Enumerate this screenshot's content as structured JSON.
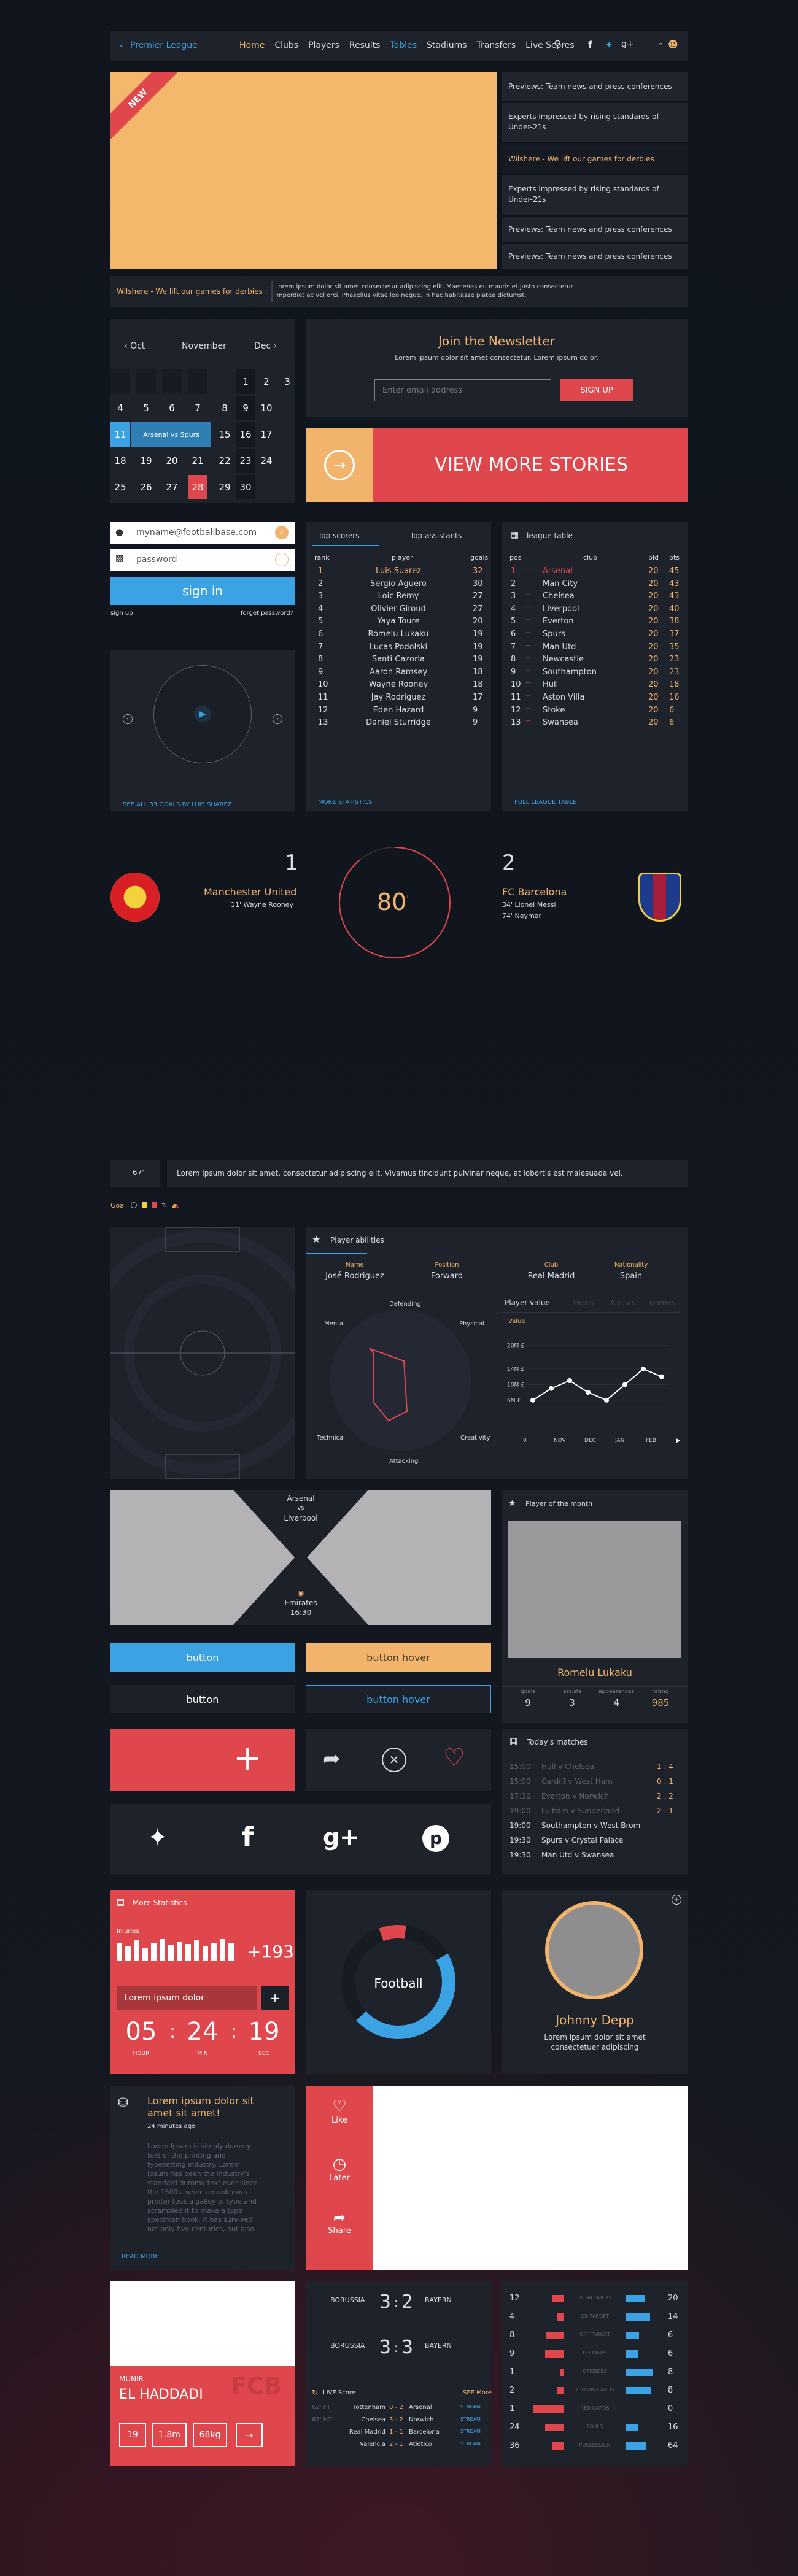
{
  "nav": {
    "brand": "Premier League",
    "links": [
      "Home",
      "Clubs",
      "Players",
      "Results",
      "Tables",
      "Stadiums",
      "Transfers",
      "Live Scores"
    ]
  },
  "hero": {
    "badge": "NEW",
    "news": [
      "Previews: Team news and press conferences",
      "Experts impressed by rising standards of Under-21s",
      "Wilshere - We lift our games for derbies",
      "Experts impressed by rising standards of Under-21s",
      "Previews: Team news and press conferences",
      "Previews: Team news and press conferences"
    ],
    "ticker_title": "Wilshere - We lift our games for derbies :",
    "ticker_text": "Lorem ipsum dolor sit amet consectetur adipiscing elit. Maecenas eu mauris et justo consectetur imperdiet ac vel orci. Phasellus vitae leo neque. In hac habitasse platea dictumst."
  },
  "calendar": {
    "prev": "Oct",
    "month": "November",
    "next": "Dec",
    "row1": [
      "1",
      "2",
      "3"
    ],
    "row2": [
      "4",
      "5",
      "6",
      "7",
      "8",
      "9",
      "10"
    ],
    "event_day": "11",
    "event_text": "Arsenal vs Spurs",
    "row3_rest": [
      "15",
      "16",
      "17"
    ],
    "row4": [
      "18",
      "19",
      "20",
      "21",
      "22",
      "23",
      "24"
    ],
    "row5": [
      "25",
      "26",
      "27",
      "28",
      "29",
      "30"
    ]
  },
  "newsletter": {
    "title": "Join the Newsletter",
    "text": "Lorem ipsum dolor sit amet consectetur. Lorem ipsum dolor.",
    "placeholder": "Enter email address",
    "button": "SIGN UP"
  },
  "stories": {
    "label": "VIEW MORE STORIES"
  },
  "login": {
    "email": "myname@footballbase.com",
    "password": "password",
    "signin": "sign in",
    "signup": "sign up",
    "forgot": "forget password?"
  },
  "player": {
    "caption": "SEE ALL 33 GOALS BY LUIS SUAREZ"
  },
  "scorers": {
    "tabs": [
      "Top scorers",
      "Top assistants"
    ],
    "headers": [
      "rank",
      "player",
      "goals"
    ],
    "rows": [
      [
        "1",
        "Luis Suarez",
        "32"
      ],
      [
        "2",
        "Sergio Aguero",
        "30"
      ],
      [
        "3",
        "Loic Remy",
        "27"
      ],
      [
        "4",
        "Olivier Giroud",
        "27"
      ],
      [
        "5",
        "Yaya Toure",
        "20"
      ],
      [
        "6",
        "Romelu Lukaku",
        "19"
      ],
      [
        "7",
        "Lucas Podolski",
        "19"
      ],
      [
        "8",
        "Santi Cazorla",
        "19"
      ],
      [
        "9",
        "Aaron Ramsey",
        "18"
      ],
      [
        "10",
        "Wayne Rooney",
        "18"
      ],
      [
        "11",
        "Jay Rodriguez",
        "17"
      ],
      [
        "12",
        "Eden Hazard",
        "9"
      ],
      [
        "13",
        "Daniel Sturridge",
        "9"
      ]
    ],
    "footer": "MORE STATISTICS"
  },
  "league": {
    "title": "league table",
    "headers": [
      "pos",
      "club",
      "pld",
      "pts"
    ],
    "rows": [
      [
        "1",
        "Arsenal",
        "20",
        "45"
      ],
      [
        "2",
        "Man City",
        "20",
        "43"
      ],
      [
        "3",
        "Chelsea",
        "20",
        "43"
      ],
      [
        "4",
        "Liverpool",
        "20",
        "40"
      ],
      [
        "5",
        "Everton",
        "20",
        "38"
      ],
      [
        "6",
        "Spurs",
        "20",
        "37"
      ],
      [
        "7",
        "Man Utd",
        "20",
        "35"
      ],
      [
        "8",
        "Newcastle",
        "20",
        "23"
      ],
      [
        "9",
        "Southampton",
        "20",
        "23"
      ],
      [
        "10",
        "Hull",
        "20",
        "18"
      ],
      [
        "11",
        "Aston Villa",
        "20",
        "16"
      ],
      [
        "12",
        "Stoke",
        "20",
        "6"
      ],
      [
        "13",
        "Swansea",
        "20",
        "6"
      ]
    ],
    "footer": "FULL LEAGUE TABLE"
  },
  "match": {
    "home_score": "1",
    "home_name": "Manchester United",
    "home_scorer": "11' Wayne Rooney",
    "minute": "80",
    "away_score": "2",
    "away_name": "FC Barcelona",
    "away_scorers": [
      "34' Lionel Messi",
      "74' Neymar"
    ]
  },
  "commentary": {
    "minute": "67'",
    "text": "Lorem ipsum dolor sit amet, consectetur adipiscing elit. Vivamus tincidunt pulvinar neque, at lobortis est malesuada vel.",
    "legend": "Goal"
  },
  "abilities": {
    "title": "Player abilities",
    "tab": "Player abilities",
    "fields": [
      {
        "label": "Name",
        "value": "José Rodriguez"
      },
      {
        "label": "Position",
        "value": "Forward"
      },
      {
        "label": "Club",
        "value": "Real Madrid"
      },
      {
        "label": "Nationality",
        "value": "Spain"
      }
    ],
    "radar": [
      "Defending",
      "Physical",
      "Creativity",
      "Attacking",
      "Technical",
      "Mental"
    ],
    "value_title": "Player value",
    "value_tabs": [
      "Goals",
      "Assists",
      "Games"
    ],
    "value_axis": "Value",
    "y_ticks": [
      "20M £",
      "14M £",
      "10M £",
      "6M £"
    ],
    "x_ticks": [
      "0",
      "NOV",
      "DEC",
      "JAN",
      "FEB"
    ]
  },
  "chart_data": {
    "type": "line",
    "title": "Player value",
    "ylabel": "Value",
    "categories": [
      "",
      "",
      "",
      "",
      "",
      "",
      "",
      ""
    ],
    "values": [
      6,
      9,
      11,
      8,
      6,
      10,
      14,
      12
    ],
    "ylim": [
      0,
      22
    ],
    "x_ticks": [
      "0",
      "NOV",
      "DEC",
      "JAN",
      "FEB"
    ],
    "y_ticks": [
      "20M £",
      "14M £",
      "10M £",
      "6M £"
    ]
  },
  "fixture": {
    "home": "Arsenal",
    "vs": "vs",
    "away": "Liverpool",
    "venue": "Emirates",
    "time": "16:30"
  },
  "potm": {
    "title": "Player of the month",
    "name": "Romelu Lukaku",
    "stats": [
      {
        "label": "goals",
        "value": "9"
      },
      {
        "label": "assists",
        "value": "3"
      },
      {
        "label": "appearances",
        "value": "4"
      },
      {
        "label": "rating",
        "value": "985"
      }
    ]
  },
  "buttons": {
    "b1": "button",
    "b2": "button hover",
    "b3": "button",
    "b4": "button hover"
  },
  "todays": {
    "title": "Today's matches",
    "rows": [
      [
        "15:00",
        "Hull v Chelsea",
        "1 : 4"
      ],
      [
        "15:00",
        "Cardiff v West Ham",
        "0 : 1"
      ],
      [
        "17:30",
        "Everton v Norwich",
        "2 : 2"
      ],
      [
        "19:00",
        "Fulham v Sunderland",
        "2 : 1"
      ],
      [
        "19:00",
        "Southampton v West Brom",
        ""
      ],
      [
        "19:30",
        "Spurs v Crystal Palace",
        ""
      ],
      [
        "19:30",
        "Man Utd v Swansea",
        ""
      ]
    ]
  },
  "more_stats": {
    "title": "More Statistics",
    "label": "Injuries",
    "value": "+193",
    "input": "Lorem ipsum dolor",
    "countdown": [
      {
        "v": "05",
        "l": "HOUR"
      },
      {
        "v": "24",
        "l": "MIN"
      },
      {
        "v": "19",
        "l": "SEC"
      }
    ]
  },
  "donut": {
    "label": "Football"
  },
  "profile": {
    "name": "Johnny Depp",
    "text": "Lorem ipsum dolor sit amet consectetuer adipiscing"
  },
  "article": {
    "title": "Lorem ipsum dolor sit amet sit amet!",
    "time": "24 minutes ago",
    "body": "Lorem Ipsum is simply dummy text of the printing and typesetting industry. Lorem Ipsum has been the industry's standard dummy text ever since the 1500s, when an unknown printer took a galley of type and scrambled it to make a type specimen book. It has survived not only five centuries, but also the leap",
    "link": "READ MORE"
  },
  "actions": {
    "like": "Like",
    "later": "Later",
    "share": "Share"
  },
  "card": {
    "first": "MUNIR",
    "last": "EL HADDADI",
    "club": "FCB",
    "stats": [
      "19",
      "1.8m",
      "68kg"
    ]
  },
  "results": [
    {
      "home": "BORUSSIA",
      "hs": "3",
      "as": "2",
      "away": "BAYERN"
    },
    {
      "home": "BORUSSIA",
      "hs": "3",
      "as": "3",
      "away": "BAYERN"
    }
  ],
  "live": {
    "title": "LIVE Score",
    "more": "SEE More",
    "rows": [
      [
        "62' FT",
        "Tottenham",
        "0 - 2",
        "Arsenal"
      ],
      [
        "67' HT",
        "Chelsea",
        "3 - 2",
        "Norwich"
      ],
      [
        "",
        "Real Madrid",
        "1 - 1",
        "Barcelona"
      ],
      [
        "",
        "Valencia",
        "2 - 1",
        "Atletico"
      ]
    ],
    "stream": "STREAM"
  },
  "compare": {
    "rows": [
      {
        "l": "12",
        "label": "TOTAL SHOTS",
        "r": "20"
      },
      {
        "l": "4",
        "label": "ON TARGET",
        "r": "14"
      },
      {
        "l": "8",
        "label": "OFF TARGET",
        "r": "6"
      },
      {
        "l": "9",
        "label": "CORNERS",
        "r": "6"
      },
      {
        "l": "1",
        "label": "OFFSIDES",
        "r": "8"
      },
      {
        "l": "2",
        "label": "YELLOW CARDS",
        "r": "8"
      },
      {
        "l": "1",
        "label": "RED CARDS",
        "r": "0"
      },
      {
        "l": "24",
        "label": "FOULS",
        "r": "16"
      },
      {
        "l": "36",
        "label": "POSSESSION",
        "r": "64"
      }
    ]
  },
  "colors": {
    "orange": "#f2b46c",
    "red": "#e0474c",
    "blue": "#3ba3e3",
    "panel": "#1b2029"
  }
}
